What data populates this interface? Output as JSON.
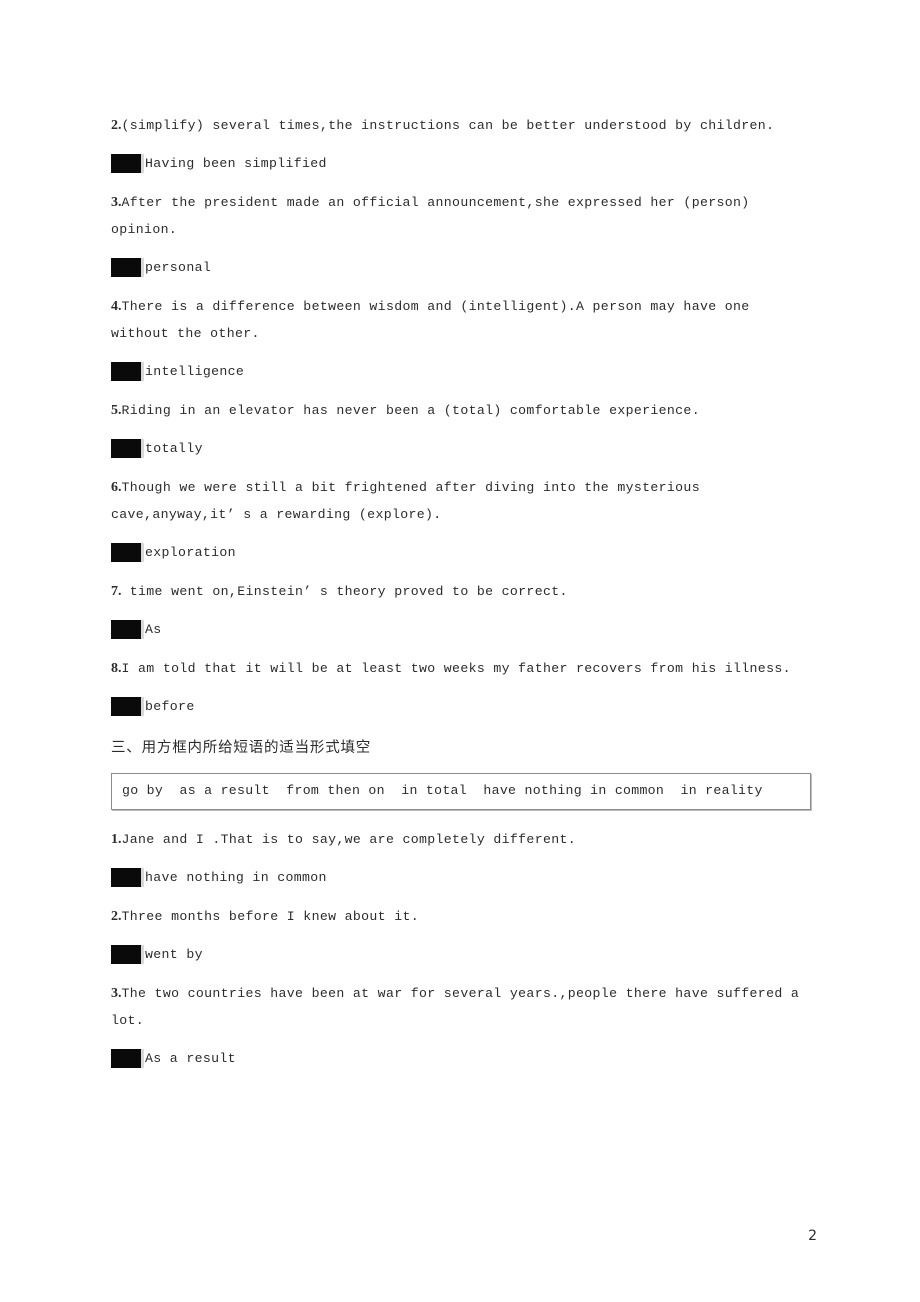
{
  "document": {
    "page_number": "2",
    "sections": [
      {
        "id": "section-two-continued",
        "items": [
          {
            "number": "2.",
            "text": "(simplify) several times,the instructions can be better understood by children.",
            "answer": "Having been simplified"
          },
          {
            "number": "3.",
            "text": "After the president made an official announcement,she expressed her (person) opinion.",
            "answer": "personal"
          },
          {
            "number": "4.",
            "text": "There is a difference between wisdom and (intelligent).A person may have one without the other.",
            "answer": "intelligence"
          },
          {
            "number": "5.",
            "text": "Riding in an elevator has never been a (total) comfortable experience.",
            "answer": "totally"
          },
          {
            "number": "6.",
            "text": "Though we were still a bit frightened after diving into the mysterious cave,anyway,it’ s a rewarding (explore).",
            "answer": "exploration"
          },
          {
            "number": "7.",
            "text": " time went on,Einstein’ s theory proved to be correct.",
            "answer": "As"
          },
          {
            "number": "8.",
            "text": "I am told that it will be at least two weeks my father recovers from his illness.",
            "answer": "before"
          }
        ]
      },
      {
        "id": "section-three",
        "heading": "三、用方框内所给短语的适当形式填空",
        "phrase_bank": "go by  as a result  from then on  in total  have nothing in common  in reality",
        "phrase_bank_items": [
          "go by",
          "as a result",
          "from then on",
          "in total",
          "have nothing in common",
          "in reality"
        ],
        "items": [
          {
            "number": "1.",
            "text": "Jane and I .That is to say,we are completely different.",
            "answer": "have nothing in common"
          },
          {
            "number": "2.",
            "text": "Three months before I knew about it.",
            "answer": "went by"
          },
          {
            "number": "3.",
            "text": "The two countries have been at war for several years.,people there have suffered a lot.",
            "answer": "As a result"
          }
        ]
      }
    ]
  }
}
